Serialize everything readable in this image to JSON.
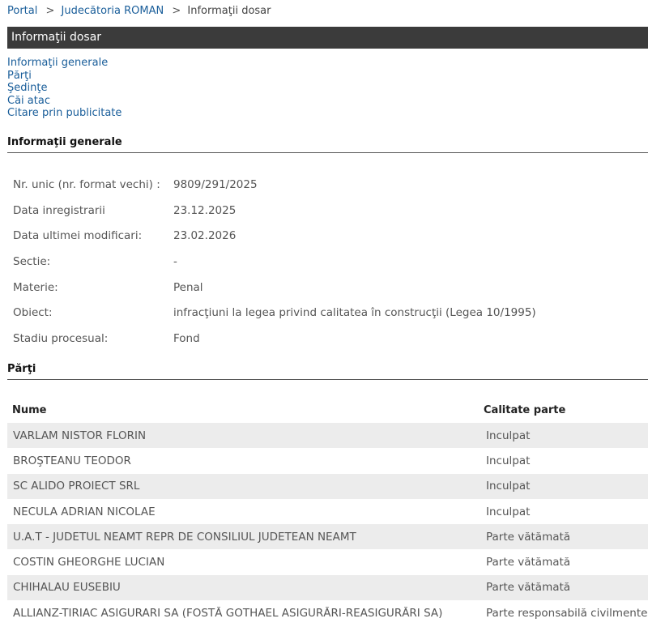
{
  "breadcrumb": {
    "portal": "Portal",
    "court": "Judecătoria ROMAN",
    "current": "Informaţii dosar",
    "separator": ">"
  },
  "title": "Informaţii dosar",
  "nav": [
    "Informaţii generale",
    "Părţi",
    "Şedinţe",
    "Căi atac",
    "Citare prin publicitate"
  ],
  "general": {
    "heading": "Informaţii generale",
    "rows": [
      {
        "label": "Nr. unic (nr. format vechi) :",
        "value": "9809/291/2025"
      },
      {
        "label": "Data inregistrarii",
        "value": "23.12.2025"
      },
      {
        "label": "Data ultimei modificari:",
        "value": "23.02.2026"
      },
      {
        "label": "Sectie:",
        "value": "-"
      },
      {
        "label": "Materie:",
        "value": "Penal"
      },
      {
        "label": "Obiect:",
        "value": "infracţiuni la legea privind calitatea în construcţii (Legea 10/1995)"
      },
      {
        "label": "Stadiu procesual:",
        "value": "Fond"
      }
    ]
  },
  "parti": {
    "heading": "Părţi",
    "columns": [
      "Nume",
      "Calitate parte"
    ],
    "rows": [
      {
        "name": "VARLAM NISTOR FLORIN",
        "role": "Inculpat"
      },
      {
        "name": "BROŞTEANU TEODOR",
        "role": "Inculpat"
      },
      {
        "name": "SC ALIDO PROIECT SRL",
        "role": "Inculpat"
      },
      {
        "name": "NECULA ADRIAN NICOLAE",
        "role": "Inculpat"
      },
      {
        "name": "U.A.T - JUDETUL NEAMT REPR DE CONSILIUL JUDETEAN NEAMT",
        "role": "Parte vătămată"
      },
      {
        "name": "COSTIN GHEORGHE LUCIAN",
        "role": "Parte vătămată"
      },
      {
        "name": "CHIHALAU EUSEBIU",
        "role": "Parte vătămată"
      },
      {
        "name": "ALLIANZ-TIRIAC ASIGURARI SA (FOSTĂ GOTHAEL ASIGURĂRI-REASIGURĂRI SA)",
        "role": "Parte responsabilă civilmente"
      }
    ]
  }
}
